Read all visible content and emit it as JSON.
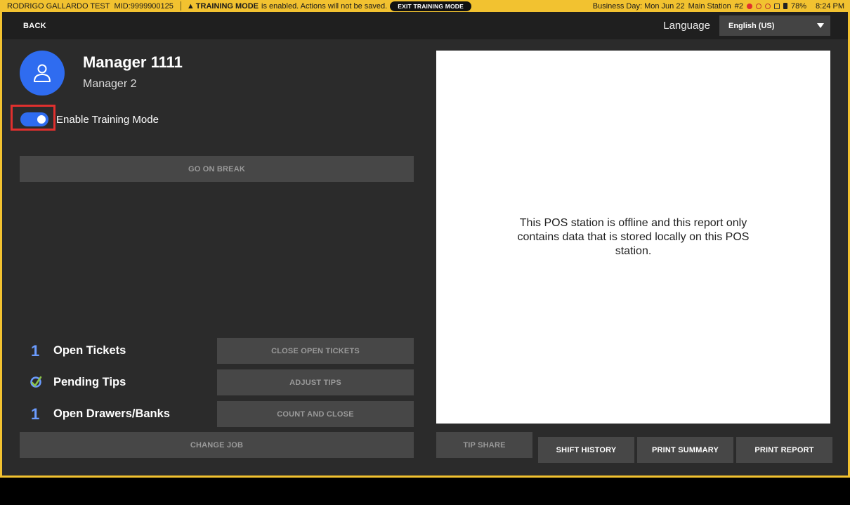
{
  "status_bar": {
    "merchant": "RODRIGO GALLARDO TEST",
    "mid": "MID:9999900125",
    "training_bold": "TRAINING MODE",
    "training_msg": "is enabled. Actions will not be saved.",
    "exit_training_label": "EXIT TRAINING MODE",
    "business_day": "Business Day: Mon Jun 22",
    "station": "Main Station",
    "station_num": "#2",
    "battery": "78%",
    "time": "8:24 PM",
    "colors": {
      "bar": "#f2c230",
      "accent_red": "#e0302e"
    }
  },
  "header": {
    "back_label": "BACK",
    "language_label": "Language",
    "language_value": "English (US)"
  },
  "employee": {
    "name": "Manager 1111",
    "role": "Manager 2",
    "avatar_icon": "user-icon",
    "avatar_color": "#2f6cf0"
  },
  "training_toggle": {
    "label": "Enable Training Mode",
    "enabled": true
  },
  "actions": {
    "go_on_break": "GO ON BREAK",
    "change_job": "CHANGE JOB"
  },
  "summary_rows": [
    {
      "count": "1",
      "label": "Open Tickets",
      "button": "CLOSE OPEN TICKETS"
    },
    {
      "count": "",
      "icon": "check-circle-icon",
      "label": "Pending Tips",
      "button": "ADJUST TIPS"
    },
    {
      "count": "1",
      "label": "Open Drawers/Banks",
      "button": "COUNT AND CLOSE"
    }
  ],
  "report": {
    "message": "This POS station is offline and this report only contains data that is stored locally on this POS station."
  },
  "footer_buttons": {
    "tip_share": "TIP SHARE",
    "shift_history": "SHIFT HISTORY",
    "print_summary": "PRINT SUMMARY",
    "print_report": "PRINT REPORT"
  }
}
